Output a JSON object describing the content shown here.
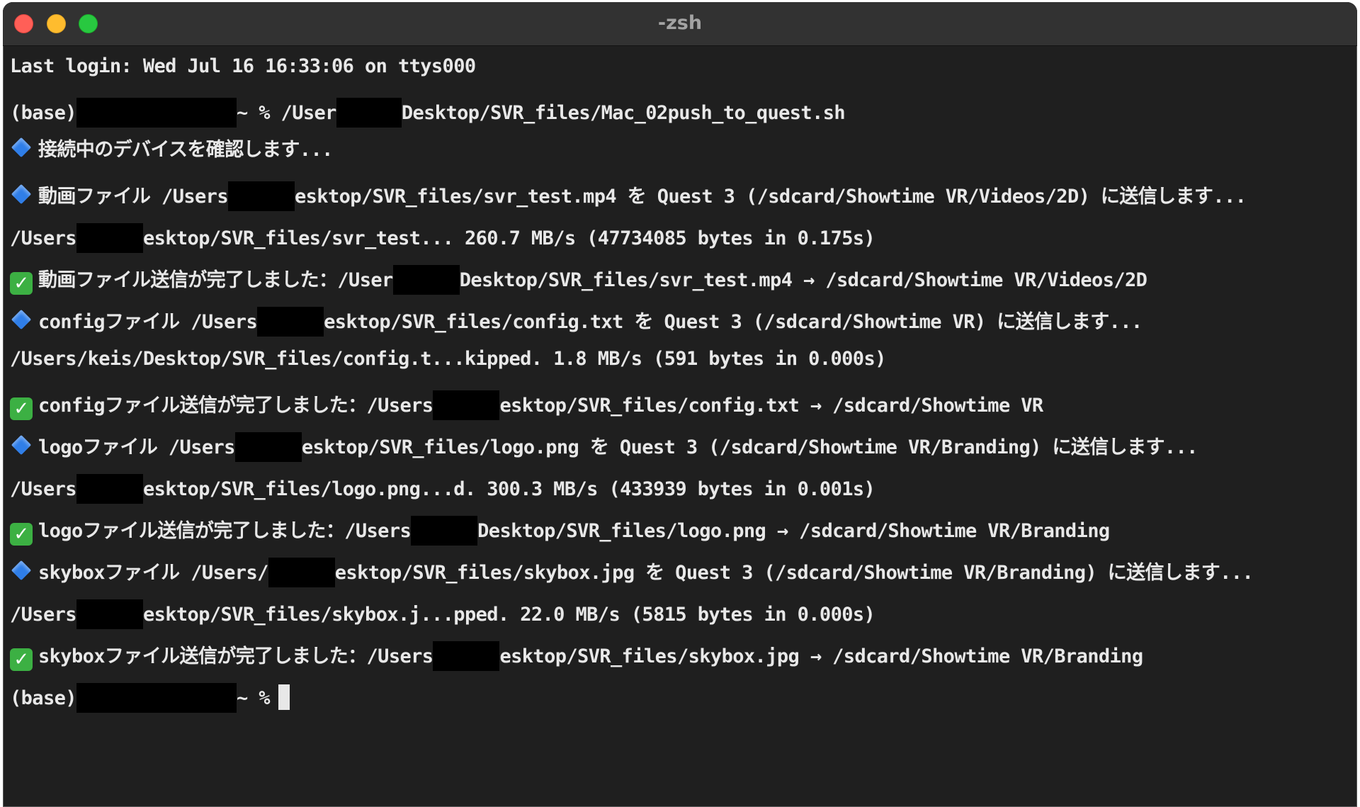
{
  "window": {
    "title": "-zsh"
  },
  "icons": {
    "info_bullet": "blue-diamond-icon",
    "done_check": "check-mark-icon",
    "check_glyph": "✓"
  },
  "colors": {
    "background": "#1f1f1f",
    "text": "#e8e8e8",
    "info_bullet": "#2f7ee8",
    "done_check": "#3cb043"
  },
  "lines": [
    {
      "a": "Last login: Wed Jul 16 16:33:06 on ttys000"
    },
    {
      "a": "(base)",
      "b": "~ % /User",
      "c": "Desktop/SVR_files/Mac_02push_to_quest.sh"
    },
    {
      "a": "接続中のデバイスを確認します..."
    },
    {
      "a": "動画ファイル /Users",
      "b": "esktop/SVR_files/svr_test.mp4 を Quest 3 (/sdcard/Showtime VR/Videos/2D) に送信します..."
    },
    {
      "a": "/Users",
      "b": "esktop/SVR_files/svr_test... 260.7 MB/s (47734085 bytes in 0.175s)"
    },
    {
      "a": "動画ファイル送信が完了しました：/User",
      "b": "Desktop/SVR_files/svr_test.mp4 → /sdcard/Showtime VR/Videos/2D"
    },
    {
      "a": "configファイル /Users",
      "b": "esktop/SVR_files/config.txt を Quest 3 (/sdcard/Showtime VR) に送信します..."
    },
    {
      "a": "/Users/keis/Desktop/SVR_files/config.t...kipped. 1.8 MB/s (591 bytes in 0.000s)"
    },
    {
      "a": "configファイル送信が完了しました：/Users",
      "b": "esktop/SVR_files/config.txt → /sdcard/Showtime VR"
    },
    {
      "a": "logoファイル /Users",
      "b": "esktop/SVR_files/logo.png を Quest 3 (/sdcard/Showtime VR/Branding) に送信します..."
    },
    {
      "a": "/Users",
      "b": "esktop/SVR_files/logo.png...d. 300.3 MB/s (433939 bytes in 0.001s)"
    },
    {
      "a": "logoファイル送信が完了しました：/Users",
      "b": "Desktop/SVR_files/logo.png → /sdcard/Showtime VR/Branding"
    },
    {
      "a": "skyboxファイル /Users/",
      "b": "esktop/SVR_files/skybox.jpg を Quest 3 (/sdcard/Showtime VR/Branding) に送信します..."
    },
    {
      "a": "/Users",
      "b": "esktop/SVR_files/skybox.j...pped. 22.0 MB/s (5815 bytes in 0.000s)"
    },
    {
      "a": "skyboxファイル送信が完了しました：/Users",
      "b": "esktop/SVR_files/skybox.jpg → /sdcard/Showtime VR/Branding"
    },
    {
      "a": "(base)",
      "b": "~ %"
    }
  ]
}
